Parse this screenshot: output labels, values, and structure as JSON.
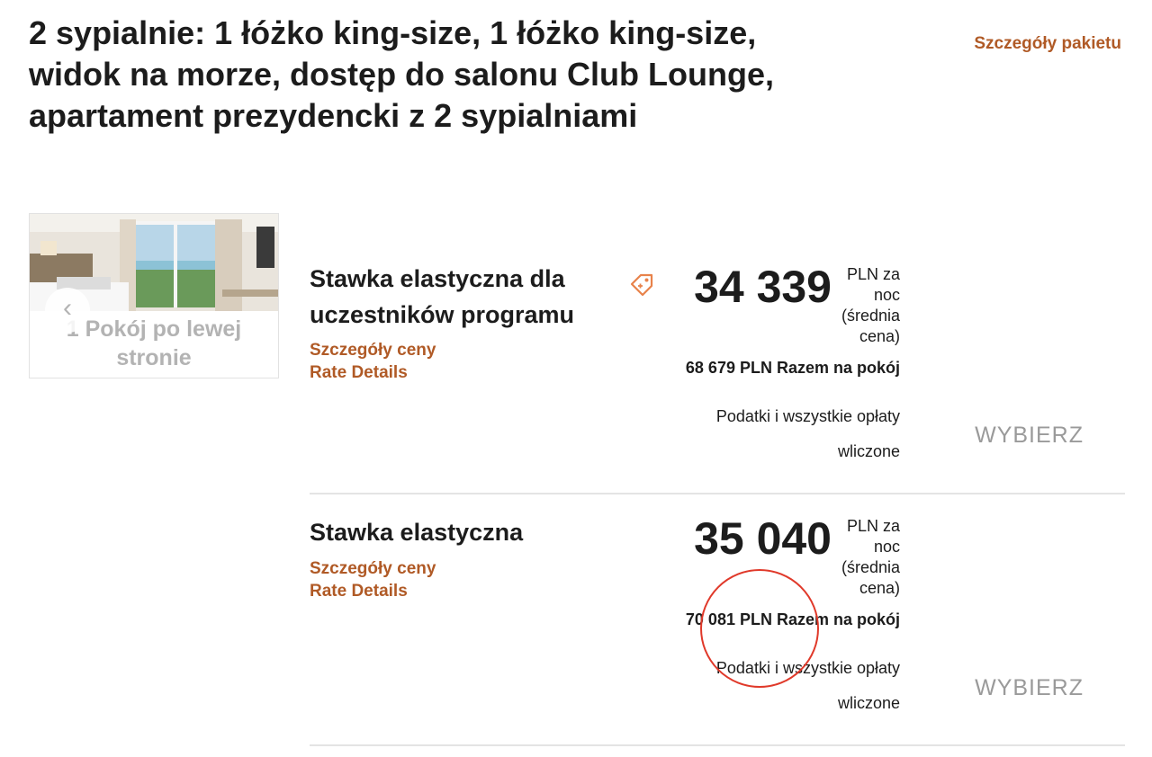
{
  "room": {
    "title": "2 sypialnie: 1 łóżko king-size, 1 łóżko king-size, widok na morze, dostęp do salonu Club Lounge, apartament prezydencki z 2 sypialniami",
    "package_link": "Szczegóły pakietu",
    "availability_badge": "1 Pokój po lewej stronie"
  },
  "rates": [
    {
      "name": "Stawka elastyczna dla uczestników programu",
      "price_details_link": "Szczegóły ceny",
      "rate_details_link": "Rate Details",
      "price": "34 339",
      "price_unit": "PLN za noc (średnia cena)",
      "total": "68 679 PLN Razem na pokój",
      "taxes": "Podatki i wszystkie opłaty wliczone",
      "select_label": "WYBIERZ",
      "has_member_tag": true
    },
    {
      "name": "Stawka elastyczna",
      "price_details_link": "Szczegóły ceny",
      "rate_details_link": "Rate Details",
      "price": "35 040",
      "price_unit": "PLN za noc (średnia cena)",
      "total": "70 081 PLN Razem na pokój",
      "taxes": "Podatki i wszystkie opłaty wliczone",
      "select_label": "WYBIERZ",
      "has_member_tag": false
    }
  ],
  "colors": {
    "accent": "#b05a26",
    "tag_icon": "#e8824a",
    "annotation_circle": "#e0392a",
    "muted_button": "#9a9a9a"
  },
  "icons": {
    "member_tag": "price-tag-icon",
    "photo_nav": "chevron-left-icon"
  }
}
